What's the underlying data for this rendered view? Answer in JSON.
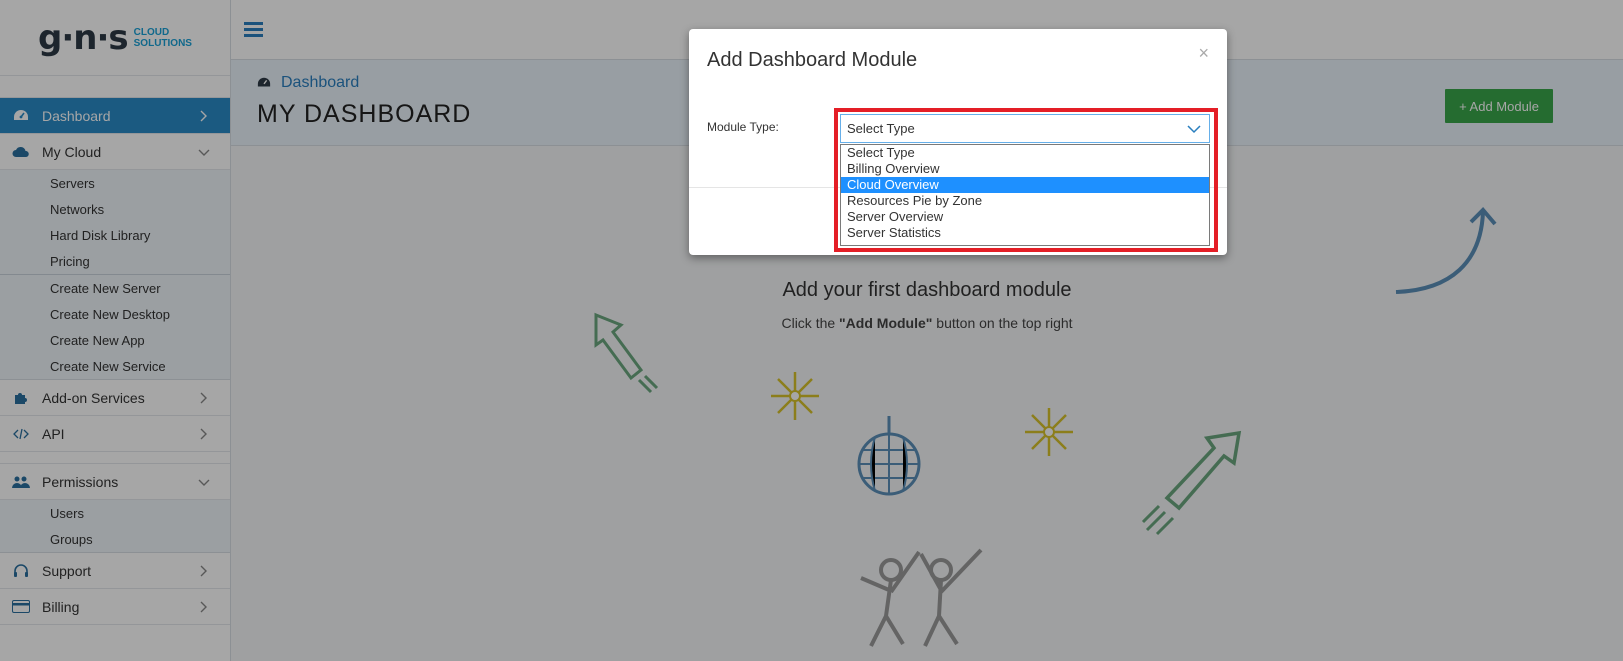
{
  "logo": {
    "mark": "g·n·s",
    "line1": "CLOUD",
    "line2": "SOLUTIONS"
  },
  "sidebar": {
    "items": [
      {
        "label": "Dashboard",
        "icon": "speedometer-icon",
        "active": true
      },
      {
        "label": "My Cloud",
        "icon": "cloud-icon"
      },
      {
        "label": "Add-on Services",
        "icon": "puzzle-icon"
      },
      {
        "label": "API",
        "icon": "code-icon"
      },
      {
        "label": "Permissions",
        "icon": "users-icon"
      },
      {
        "label": "Support",
        "icon": "headset-icon"
      },
      {
        "label": "Billing",
        "icon": "credit-card-icon"
      }
    ],
    "my_cloud_sub": [
      "Servers",
      "Networks",
      "Hard Disk Library",
      "Pricing"
    ],
    "my_cloud_create": [
      "Create New Server",
      "Create New Desktop",
      "Create New App",
      "Create New Service"
    ],
    "permissions_sub": [
      "Users",
      "Groups"
    ]
  },
  "header": {
    "breadcrumb": "Dashboard",
    "title": "MY DASHBOARD",
    "add_module": "+ Add Module"
  },
  "empty_state": {
    "title": "Add your first dashboard module",
    "sub_prefix": "Click the ",
    "sub_bold": "\"Add Module\"",
    "sub_suffix": " button on the top right"
  },
  "modal": {
    "title": "Add Dashboard Module",
    "close": "×",
    "label": "Module Type:",
    "selected": "Select Type",
    "options": [
      "Select Type",
      "Billing Overview",
      "Cloud Overview",
      "Resources Pie by Zone",
      "Server Overview",
      "Server Statistics"
    ],
    "highlighted_option": "Cloud Overview"
  },
  "colors": {
    "accent": "#2a8bc7",
    "button_green": "#3aa64a",
    "highlight_red": "#e41e26",
    "option_selected": "#1e90ff"
  }
}
